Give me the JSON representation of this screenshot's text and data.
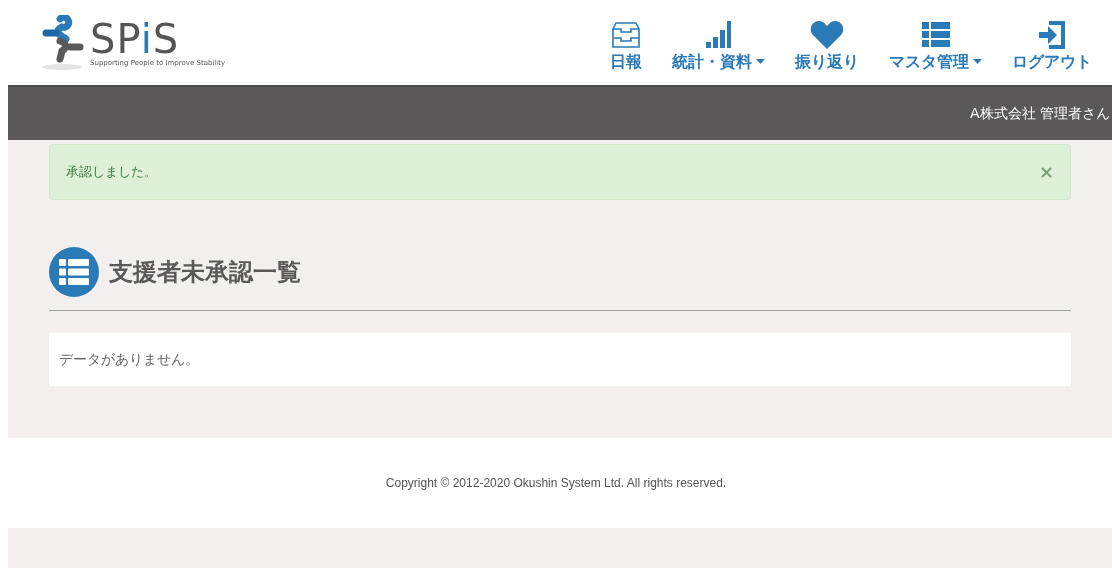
{
  "logo": {
    "segments": [
      {
        "text": "SP",
        "accent": false
      },
      {
        "text": "i",
        "accent": true
      },
      {
        "text": "S",
        "accent": false
      }
    ],
    "tagline": "Supporting People to Improve Stability"
  },
  "nav": [
    {
      "label": "日報",
      "kind": "tray",
      "dropdown": false
    },
    {
      "label": "統計・資料",
      "kind": "bars",
      "dropdown": true
    },
    {
      "label": "振り返り",
      "kind": "heart",
      "dropdown": false
    },
    {
      "label": "マスタ管理",
      "kind": "list",
      "dropdown": true
    },
    {
      "label": "ログアウト",
      "kind": "login",
      "dropdown": false
    }
  ],
  "user_bar": {
    "user": "A株式会社 管理者さん"
  },
  "alert": {
    "message": "承認しました。",
    "close": "×"
  },
  "page_title": "支援者未承認一覧",
  "empty_message": "データがありません。",
  "footer": "Copyright © 2012-2020 Okushin System Ltd. All rights reserved."
}
